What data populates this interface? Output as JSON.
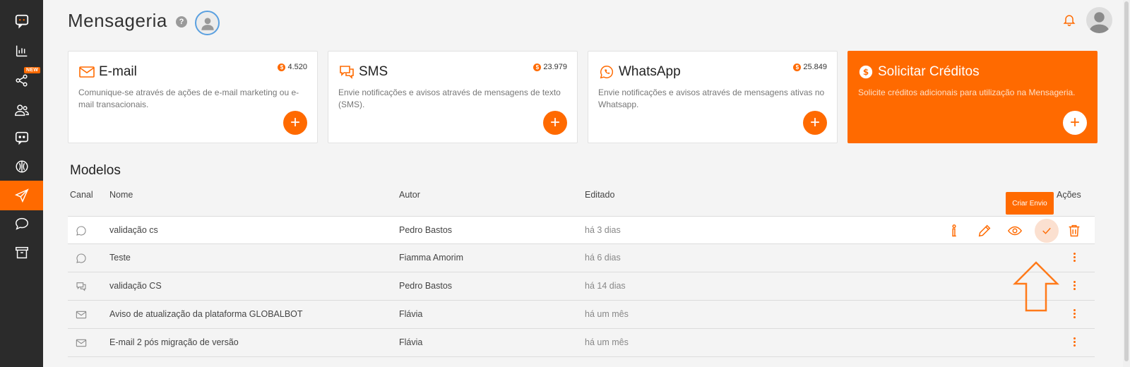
{
  "sidebar": {
    "items": [
      {
        "name": "logo",
        "icon": "chat-logo-icon"
      },
      {
        "name": "analytics",
        "icon": "bar-chart-icon"
      },
      {
        "name": "flows",
        "icon": "share-nodes-icon",
        "badge": "NEW"
      },
      {
        "name": "contacts",
        "icon": "users-icon"
      },
      {
        "name": "bots",
        "icon": "bot-icon"
      },
      {
        "name": "brain",
        "icon": "brain-icon"
      },
      {
        "name": "messaging",
        "icon": "send-icon",
        "active": true
      },
      {
        "name": "conversations",
        "icon": "speech-bubble-icon"
      },
      {
        "name": "archive",
        "icon": "archive-icon"
      }
    ]
  },
  "header": {
    "title": "Mensageria",
    "help": "?"
  },
  "colors": {
    "accent": "#ff6a00",
    "sidebar": "#2b2b2b"
  },
  "cards": {
    "email": {
      "title": "E-mail",
      "credit": "4.520",
      "desc": "Comunique-se através de ações de e-mail marketing ou e-mail transacionais."
    },
    "sms": {
      "title": "SMS",
      "credit": "23.979",
      "desc": "Envie notificações e avisos através de mensagens de texto (SMS)."
    },
    "whatsapp": {
      "title": "WhatsApp",
      "credit": "25.849",
      "desc": "Envie notificações e avisos através de mensagens ativas no Whatsapp."
    },
    "credits": {
      "title": "Solicitar Créditos",
      "desc": "Solicite créditos adicionais para utilização na Mensageria."
    },
    "add_label": "+",
    "coin_label": "$"
  },
  "models": {
    "title": "Modelos",
    "columns": {
      "canal": "Canal",
      "nome": "Nome",
      "autor": "Autor",
      "editado": "Editado",
      "acoes": "Ações"
    },
    "rows": [
      {
        "canal": "whatsapp-icon",
        "nome": "validação cs",
        "autor": "Pedro Bastos",
        "editado": "há 3 dias"
      },
      {
        "canal": "whatsapp-icon",
        "nome": "Teste",
        "autor": "Fiamma Amorim",
        "editado": "há 6 dias"
      },
      {
        "canal": "sms-icon",
        "nome": "validação CS",
        "autor": "Pedro Bastos",
        "editado": "há 14 dias"
      },
      {
        "canal": "email-icon",
        "nome": "Aviso de atualização da plataforma GLOBALBOT",
        "autor": "Flávia",
        "editado": "há um mês"
      },
      {
        "canal": "email-icon",
        "nome": "E-mail 2 pós migração de versão",
        "autor": "Flávia",
        "editado": "há um mês"
      }
    ],
    "tooltip": "Criar Envio"
  }
}
